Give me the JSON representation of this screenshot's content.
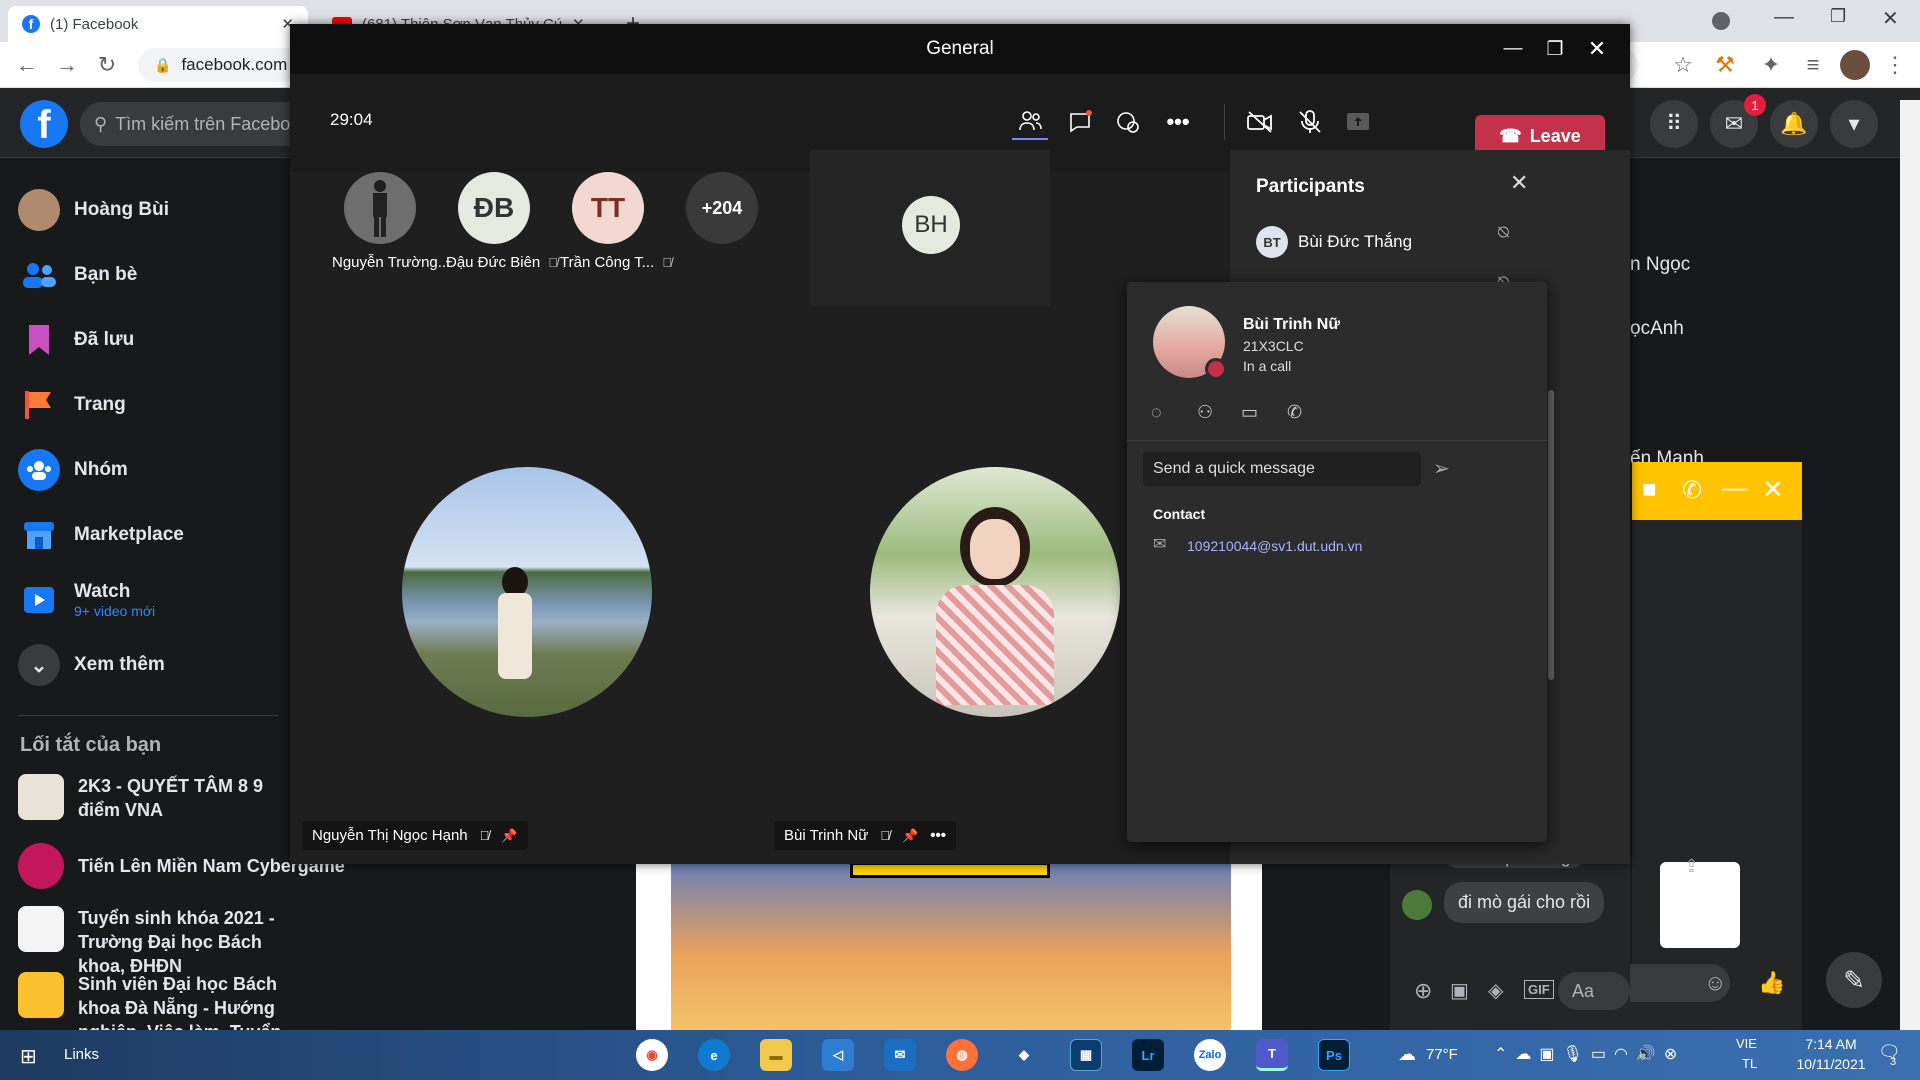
{
  "browser": {
    "tab1_title": "(1) Facebook",
    "tab2_title": "(681) Thiên Sơn Vạn Thủy Cứ",
    "url": "facebook.com"
  },
  "facebook": {
    "search_placeholder": "Tìm kiếm trên Facebook",
    "notification_count": "1",
    "sidebar": [
      {
        "label": "Hoàng Bùi"
      },
      {
        "label": "Bạn bè"
      },
      {
        "label": "Đã lưu"
      },
      {
        "label": "Trang"
      },
      {
        "label": "Nhóm"
      },
      {
        "label": "Marketplace"
      },
      {
        "label": "Watch",
        "sub": "9+ video mới"
      },
      {
        "label": "Xem thêm"
      }
    ],
    "shortcuts_title": "Lối tắt của bạn",
    "shortcuts": [
      {
        "label": "2K3 - QUYẾT TÂM 8 9 điểm VNA"
      },
      {
        "label": "Tiến Lên Miền Nam Cybergame"
      },
      {
        "label": "Tuyển sinh khóa 2021 - Trường Đại học Bách khoa, ĐHĐN"
      },
      {
        "label": "Sinh viên Đại học Bách khoa Đà Nẵng - Hướng nghiệp, Việc làm, Tuyển dụng"
      }
    ],
    "contacts": [
      "n Ngọc",
      "ọcAnh",
      "ến Mạnh"
    ],
    "chat": {
      "message_1": "chán quá nàng",
      "message_2": "đi mò gái cho rồi",
      "input_placeholder": "Aa"
    }
  },
  "teams": {
    "window_title": "General",
    "timer": "29:04",
    "leave_label": "Leave",
    "top_attendees": [
      {
        "initials": "",
        "name": "Nguyễn Trường..."
      },
      {
        "initials": "ĐB",
        "name": "Đậu Đức Biên"
      },
      {
        "initials": "TT",
        "name": "Trần Công T..."
      },
      {
        "initials": "+204",
        "name": ""
      }
    ],
    "bh_initials": "BH",
    "video_1_name": "Nguyễn Thị Ngọc Hạnh",
    "video_2_name": "Bùi Trinh Nữ",
    "participants_title": "Participants",
    "first_participant": {
      "initials": "BT",
      "name": "Bùi Đức Thắng"
    },
    "card": {
      "name": "Bùi Trinh Nữ",
      "dept": "21X3CLC",
      "status": "In a call",
      "quick_message_placeholder": "Send a quick message",
      "contact_label": "Contact",
      "email": "109210044@sv1.dut.udn.vn"
    }
  },
  "taskbar": {
    "links": "Links",
    "temp": "77°F",
    "lang1": "VIE",
    "lang2": "TL",
    "time": "7:14 AM",
    "date": "10/11/2021",
    "notif_count": "3"
  },
  "colors": {
    "leave": "#c4314b",
    "facebook_blue": "#1877f2",
    "chat_head": "#ffc300"
  }
}
